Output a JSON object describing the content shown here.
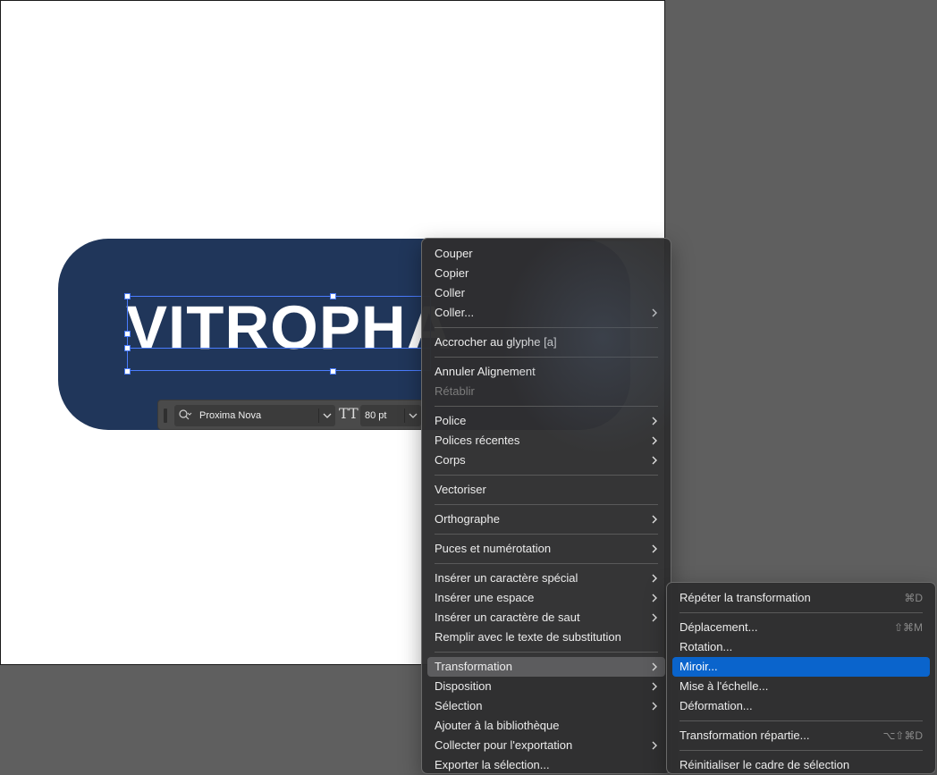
{
  "canvas": {
    "headline": "VITROPHA",
    "pill_color": "#20365a"
  },
  "control_bar": {
    "font_name": "Proxima Nova",
    "font_size": "80 pt",
    "size_icon": "TT"
  },
  "context_menu": {
    "items": [
      {
        "label": "Couper"
      },
      {
        "label": "Copier"
      },
      {
        "label": "Coller"
      },
      {
        "label": "Coller...",
        "submenu": true
      },
      {
        "label": "Accrocher au glyphe [a]"
      },
      {
        "label": "Annuler Alignement"
      },
      {
        "label": "Rétablir",
        "disabled": true
      },
      {
        "label": "Police",
        "submenu": true
      },
      {
        "label": "Polices récentes",
        "submenu": true
      },
      {
        "label": "Corps",
        "submenu": true
      },
      {
        "label": "Vectoriser"
      },
      {
        "label": "Orthographe",
        "submenu": true
      },
      {
        "label": "Puces et numérotation",
        "submenu": true
      },
      {
        "label": "Insérer un caractère spécial",
        "submenu": true
      },
      {
        "label": "Insérer une espace",
        "submenu": true
      },
      {
        "label": "Insérer un caractère de saut",
        "submenu": true
      },
      {
        "label": "Remplir avec le texte de substitution"
      },
      {
        "label": "Transformation",
        "submenu": true,
        "highlighted": true
      },
      {
        "label": "Disposition",
        "submenu": true
      },
      {
        "label": "Sélection",
        "submenu": true
      },
      {
        "label": "Ajouter à la bibliothèque"
      },
      {
        "label": "Collecter pour l'exportation",
        "submenu": true
      },
      {
        "label": "Exporter la sélection..."
      }
    ]
  },
  "transform_submenu": {
    "items": [
      {
        "label": "Répéter la transformation",
        "shortcut": "⌘D"
      },
      {
        "label": "Déplacement...",
        "shortcut": "⇧⌘M"
      },
      {
        "label": "Rotation..."
      },
      {
        "label": "Miroir...",
        "active": true
      },
      {
        "label": "Mise à l'échelle..."
      },
      {
        "label": "Déformation..."
      },
      {
        "label": "Transformation répartie...",
        "shortcut": "⌥⇧⌘D"
      },
      {
        "label": "Réinitialiser le cadre de sélection"
      }
    ]
  },
  "colors": {
    "accent": "#0a64cc",
    "selection": "#4a7cff",
    "menu_bg": "#2e2e30",
    "workspace": "#5f5f5f"
  }
}
